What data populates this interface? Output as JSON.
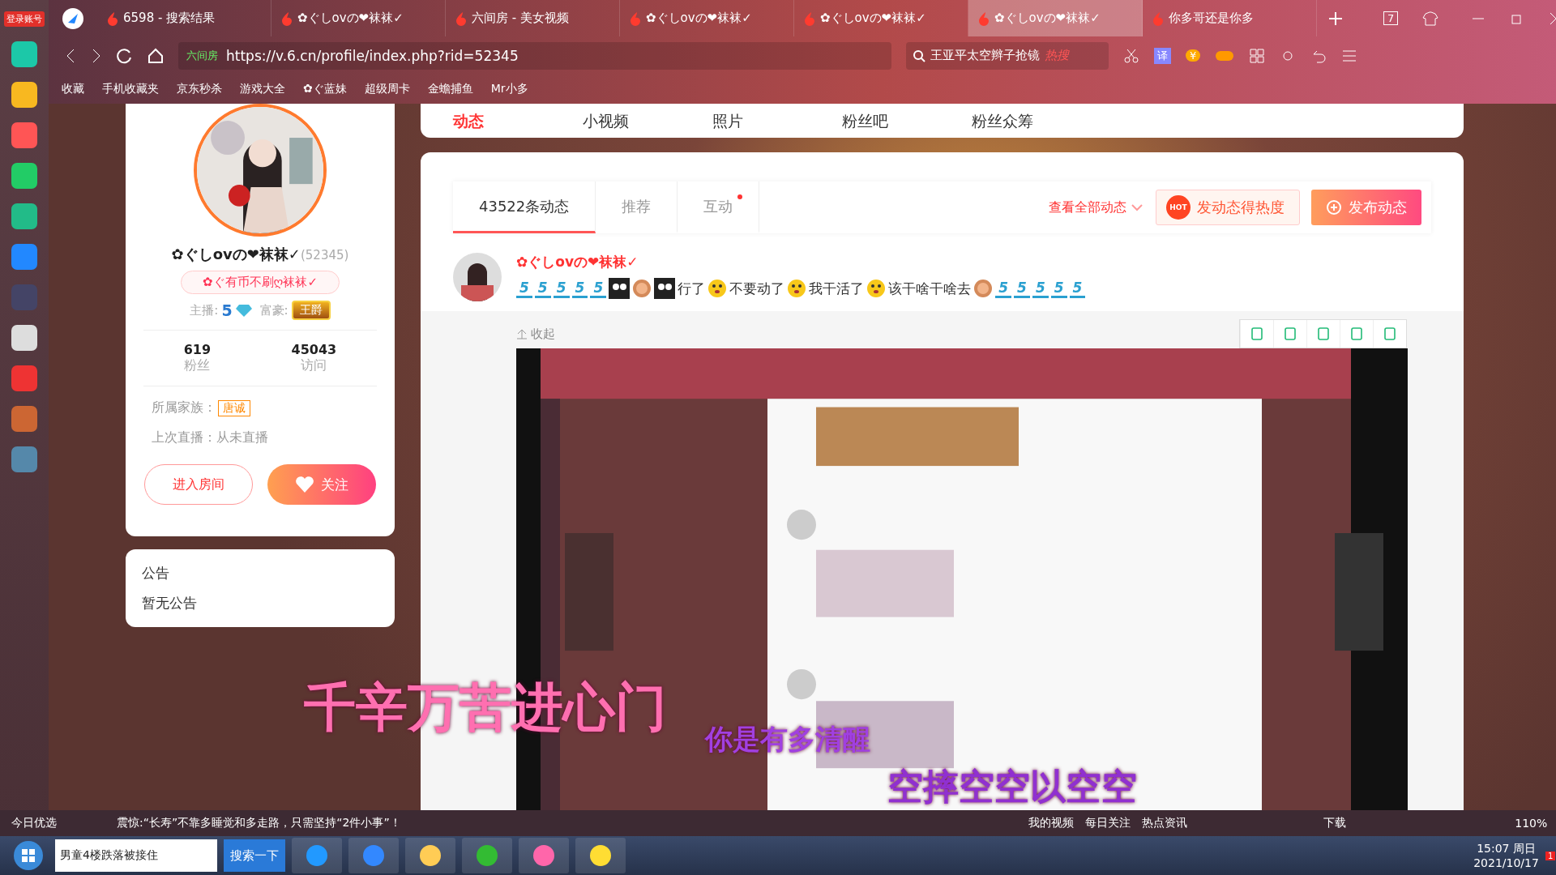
{
  "browser": {
    "login": "登录账号",
    "tabs": [
      {
        "label": "6598 - 搜索结果",
        "selected": false
      },
      {
        "label": "✿ぐしovの❤袜袜✓",
        "selected": false
      },
      {
        "label": "六间房 - 美女视频",
        "selected": false
      },
      {
        "label": "✿ぐしovの❤袜袜✓",
        "selected": false
      },
      {
        "label": "✿ぐしovの❤袜袜✓",
        "selected": false
      },
      {
        "label": "✿ぐしovの❤袜袜✓",
        "selected": true
      },
      {
        "label": "你多哥还是你多",
        "selected": false
      }
    ],
    "tab_count": "7",
    "site_tag": "六间房",
    "url": "https://v.6.cn/profile/index.php?rid=52345",
    "search": {
      "value": "王亚平太空辫子抢镜",
      "hot": "热搜"
    },
    "translate": "译",
    "coin": "¥",
    "bookmarks": [
      "收藏",
      "手机收藏夹",
      "京东秒杀",
      "游戏大全",
      "✿ぐ蓝妹",
      "超级周卡",
      "金蟾捕鱼",
      "Mr小多"
    ]
  },
  "nav_tabs": [
    {
      "label": "动态",
      "selected": true
    },
    {
      "label": "小视频",
      "selected": false
    },
    {
      "label": "照片",
      "selected": false
    },
    {
      "label": "粉丝吧",
      "selected": false
    },
    {
      "label": "粉丝众筹",
      "selected": false
    }
  ],
  "profile": {
    "name": "✿ぐしovの❤袜袜✓",
    "id": "(52345)",
    "signature": "✿ぐ有币不刷ღ袜袜✓",
    "anchor_label": "主播:",
    "anchor_level": "5",
    "rich_label": "富豪:",
    "rich_rank": "王爵",
    "stats": [
      {
        "value": "619",
        "label": "粉丝"
      },
      {
        "value": "45043",
        "label": "访问"
      }
    ],
    "family_label": "所属家族：",
    "family": "唐诚",
    "last_live": "上次直播：从未直播",
    "enter_button": "进入房间",
    "follow_button": "关注"
  },
  "notice": {
    "title": "公告",
    "text": "暂无公告"
  },
  "feed": {
    "tabs": [
      {
        "label": "43522条动态",
        "selected": true,
        "dot": false
      },
      {
        "label": "推荐",
        "selected": false,
        "dot": false
      },
      {
        "label": "互动",
        "selected": false,
        "dot": true
      }
    ],
    "filter": "查看全部动态",
    "hot_button": "发动态得热度",
    "hot_badge": "HOT",
    "publish_button": "发布动态",
    "post": {
      "author": "✿ぐしovの❤袜袜✓",
      "segments": [
        {
          "kind": "level",
          "text": "5"
        },
        {
          "kind": "level",
          "text": "5"
        },
        {
          "kind": "level",
          "text": "5"
        },
        {
          "kind": "level",
          "text": "5"
        },
        {
          "kind": "level",
          "text": "5"
        },
        {
          "kind": "face"
        },
        {
          "kind": "medal"
        },
        {
          "kind": "face"
        },
        {
          "kind": "text",
          "text": "行了"
        },
        {
          "kind": "smiley"
        },
        {
          "kind": "text",
          "text": "不要动了"
        },
        {
          "kind": "smiley"
        },
        {
          "kind": "text",
          "text": "我干活了"
        },
        {
          "kind": "smiley"
        },
        {
          "kind": "text",
          "text": "该干啥干啥去"
        },
        {
          "kind": "medal"
        },
        {
          "kind": "level",
          "text": "5"
        },
        {
          "kind": "level",
          "text": "5"
        },
        {
          "kind": "level",
          "text": "5"
        },
        {
          "kind": "level",
          "text": "5"
        },
        {
          "kind": "level",
          "text": "5"
        }
      ],
      "collapse": "收起"
    }
  },
  "lyrics": [
    "千辛万苦进心门",
    "你是有多清醒",
    "空摔空空以空空"
  ],
  "status_bar": {
    "left": "今日优选",
    "news": "震惊:“长寿”不靠多睡觉和多走路，只需坚持“2件小事”！",
    "right": [
      "我的视频",
      "每日关注",
      "热点资讯"
    ],
    "download": "下载",
    "zoom": "110%"
  },
  "taskbar": {
    "search": "男童4楼跌落被接住",
    "search_button": "搜索一下",
    "time": "15:07 周日",
    "date": "2021/10/17",
    "badge": "1"
  }
}
